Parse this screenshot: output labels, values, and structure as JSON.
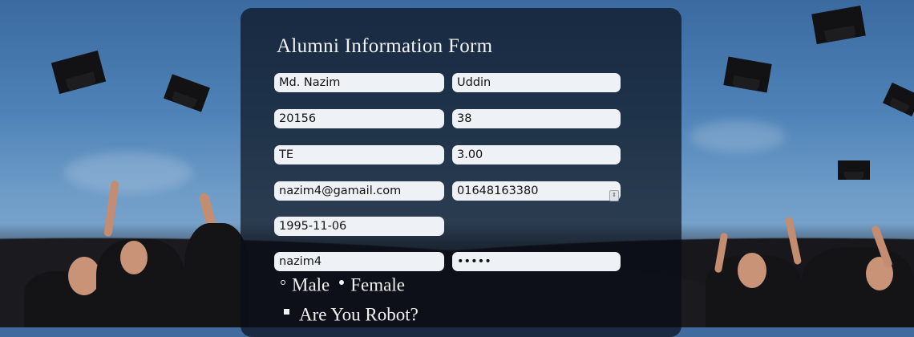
{
  "form": {
    "title": "Alumni Information Form",
    "first_name": "Md. Nazim",
    "last_name": "Uddin",
    "student_id": "20156",
    "batch": "38",
    "department": "TE",
    "cgpa": "3.00",
    "email": "nazim4@gamail.com",
    "phone": "01648163380",
    "birth_date": "1995-11-06",
    "username": "nazim4",
    "password": "•••••",
    "gender_options": [
      "Male",
      "Female"
    ],
    "gender_selected": "Female",
    "robot_label": "Are You Robot?"
  },
  "colors": {
    "panel_bg": "#080c14",
    "field_bg": "#eef2f6",
    "text_light": "#f1f1f1"
  }
}
